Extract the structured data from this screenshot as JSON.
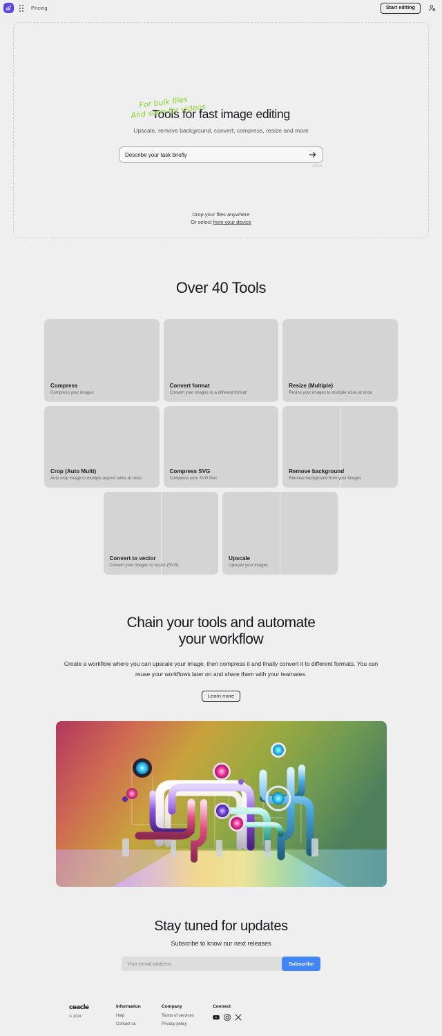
{
  "colors": {
    "page_bg": "#efefef",
    "logo_purple": "#5b45e0",
    "card_gray": "#d4d4d4",
    "accent_blue": "#4285f4",
    "scribble_green": "#8ad42a"
  },
  "topbar": {
    "logo_icon": "ceacle-logo-icon",
    "apps_icon": "grid-apps-icon",
    "nav_link": "Pricing",
    "start_button": "Start editing",
    "account_icon": "user-account-icon"
  },
  "hero": {
    "scribble_line1": "For bulk files",
    "scribble_line2": "And soon for videos",
    "title": "Tools for fast image editing",
    "subtitle": "Upscale, remove background, convert, compress, resize and more",
    "prompt_placeholder": "Describe your task briefly",
    "prompt_value": "",
    "send_icon": "send-arrow-icon",
    "char_count": "0/150",
    "drop_line1": "Drop your files anywhere",
    "drop_line2_prefix": "Or select ",
    "drop_line2_link": "from your device"
  },
  "tools": {
    "title": "Over 40 Tools",
    "items": [
      {
        "name": "Compress",
        "desc": "Compress your images",
        "split": false
      },
      {
        "name": "Convert format",
        "desc": "Convert your images to a different format",
        "split": false
      },
      {
        "name": "Resize (Multiple)",
        "desc": "Resize your images to multiple sizes at once",
        "split": false
      },
      {
        "name": "Crop (Auto Multi)",
        "desc": "Auto crop image to multiple aspect ratios at once",
        "split": false
      },
      {
        "name": "Compress SVG",
        "desc": "Compress your SVG files",
        "split": false
      },
      {
        "name": "Remove background",
        "desc": "Remove background from your images",
        "split": true
      },
      {
        "name": "Convert to vector",
        "desc": "Convert your images to vector (SVG)",
        "split": true
      },
      {
        "name": "Upscale",
        "desc": "Upscale your images",
        "split": true
      }
    ]
  },
  "chain": {
    "heading_line1": "Chain your tools and automate",
    "heading_line2": "your workflow",
    "body": "Create a workflow where you can upscale your image, then compress it and finally convert it to different formats. You can reuse your workflows later on and share them with your teamates.",
    "learn_more": "Learn more",
    "illustration": "colorful-3d-pipes-illustration"
  },
  "newsletter": {
    "title": "Stay tuned for updates",
    "subtitle": "Subscribe to know our next releases",
    "email_placeholder": "Your email address",
    "email_value": "",
    "subscribe_button": "Subscribe"
  },
  "footer": {
    "brand": "ceacle",
    "copyright": "© 2024",
    "columns": [
      {
        "heading": "Information",
        "links": [
          "Help",
          "Contact us"
        ]
      },
      {
        "heading": "Company",
        "links": [
          "Terms of services",
          "Privacy policy"
        ]
      }
    ],
    "connect_heading": "Connect",
    "socials": [
      "youtube-icon",
      "instagram-icon",
      "x-twitter-icon"
    ]
  }
}
